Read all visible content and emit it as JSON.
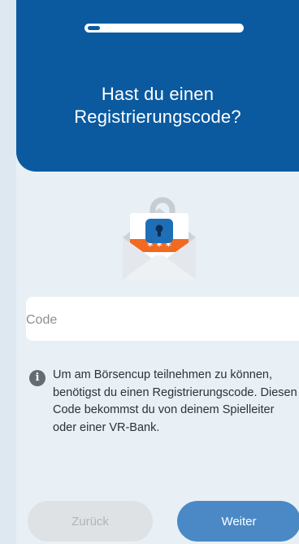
{
  "header": {
    "title_line1": "Hast du einen",
    "title_line2": "Registrierungscode?",
    "progress_fraction": 0.08,
    "background_color": "#0b5aa0"
  },
  "illustration": {
    "icon": "envelope-lock-icon",
    "code_mask": "* * *"
  },
  "form": {
    "code_placeholder": "Code",
    "code_value": ""
  },
  "info": {
    "icon": "info-icon",
    "glyph": "i",
    "text": "Um am Börsencup teilnehmen zu können, benötigst du einen Registrierungscode. Diesen Code bekommst du von deinem Spielleiter oder einer VR-Bank."
  },
  "buttons": {
    "back_label": "Zurück",
    "next_label": "Weiter"
  },
  "colors": {
    "accent": "#4a89c6",
    "disabled": "#dfe2e5",
    "lock_orange": "#f06a22"
  }
}
